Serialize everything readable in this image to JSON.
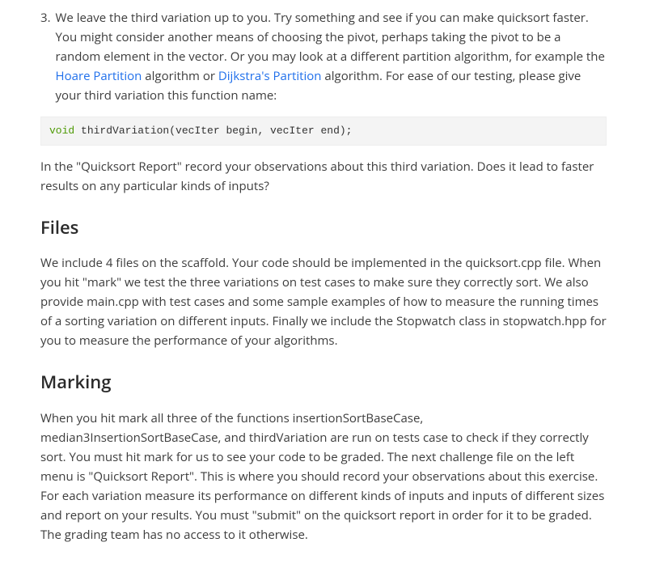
{
  "item3": {
    "number": "3.",
    "text_before_link1": "We leave the third variation up to you.  Try something and see if you can make quicksort faster.  You might consider another means of choosing the pivot, perhaps taking the pivot to be a random element in the vector.  Or you may look at a different partition algorithm, for example the ",
    "link1": "Hoare Partition",
    "text_between": " algorithm or ",
    "link2": "Dijkstra's Partition",
    "text_after_link2": " algorithm.  For ease of our testing, please give your third variation this function name:"
  },
  "code": {
    "keyword": "void",
    "rest": " thirdVariation(vecIter begin, vecIter end);"
  },
  "followup": "In the \"Quicksort Report\" record your observations about this third variation.  Does it lead to faster results on any particular kinds of inputs?",
  "files": {
    "heading": "Files",
    "body": "We include 4 files on the scaffold.  Your code should be implemented in the quicksort.cpp file.  When you hit \"mark\" we test the three variations on test cases to make sure they correctly sort.  We also provide main.cpp with test cases and some sample examples of how to measure the running times of a sorting variation on different inputs.  Finally we include the Stopwatch class in stopwatch.hpp for you to measure the performance of your algorithms."
  },
  "marking": {
    "heading": "Marking",
    "body": "When you hit mark all three of the functions insertionSortBaseCase, median3InsertionSortBaseCase, and thirdVariation are run on tests case to check if they correctly sort.  You must hit mark for us to see your code to be graded.  The next challenge file on the left menu is \"Quicksort Report\".  This is where you should record your observations about this exercise.  For each variation measure its performance on different kinds of inputs and inputs of different sizes and report on your results.  You must \"submit\" on the quicksort report in order for it to be graded.  The grading team has no access to it otherwise."
  }
}
